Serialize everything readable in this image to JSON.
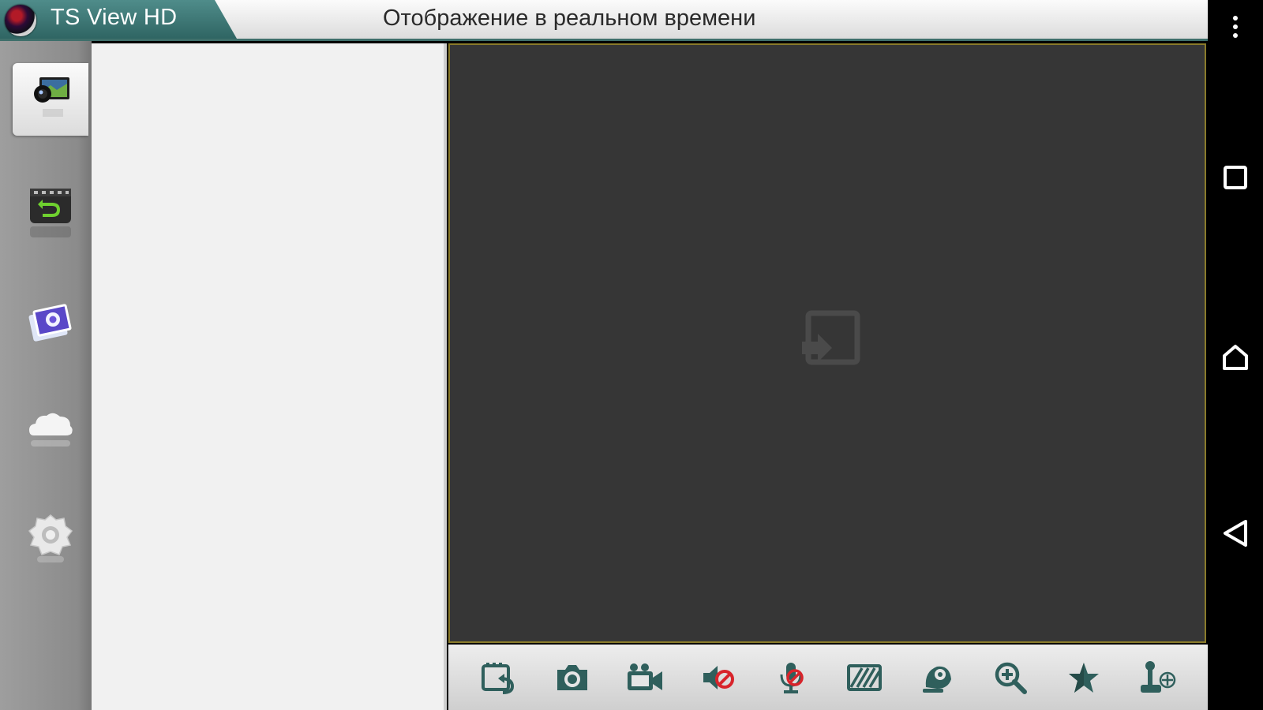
{
  "header": {
    "app_title": "TS View HD",
    "page_title": "Отображение в реальном времени"
  },
  "sidebar": {
    "items": [
      {
        "id": "live-view",
        "icon": "live-view-icon",
        "active": true
      },
      {
        "id": "playback",
        "icon": "playback-icon",
        "active": false
      },
      {
        "id": "gallery",
        "icon": "gallery-icon",
        "active": false
      },
      {
        "id": "cloud",
        "icon": "cloud-icon",
        "active": false
      },
      {
        "id": "settings",
        "icon": "settings-icon",
        "active": false
      }
    ]
  },
  "video": {
    "empty_icon": "add-camera-icon"
  },
  "toolbar": {
    "tools": [
      "playback-switch-icon",
      "snapshot-icon",
      "record-icon",
      "audio-off-icon",
      "talk-off-icon",
      "image-quality-icon",
      "ptz-icon",
      "zoom-icon",
      "favorites-icon",
      "joystick-icon"
    ]
  },
  "system_nav": [
    "more-options-icon",
    "recent-apps-icon",
    "home-icon",
    "back-icon"
  ],
  "colors": {
    "accent": "#3e6f6b",
    "icon_green": "#2f5f5c",
    "warning_red": "#d8242b",
    "video_bg": "#363636",
    "video_border": "#8a7b2a"
  }
}
